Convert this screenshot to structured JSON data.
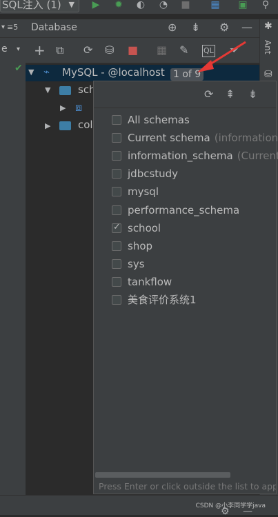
{
  "toolbar": {
    "run_config_label": "SQL注入 (1)",
    "icons": [
      "run-icon",
      "debug-icon",
      "coverage-icon",
      "profile-icon",
      "stop-icon",
      "build-icon",
      "console-icon",
      "search-icon"
    ]
  },
  "left_panel": {
    "count_label": "≡5",
    "dropdown_label": "e"
  },
  "database_panel": {
    "title": "Database",
    "header_icons": [
      "crosshair-icon",
      "collapse-icon",
      "settings-icon",
      "minimize-icon"
    ],
    "toolbar_icons": [
      "add-icon",
      "copy-icon",
      "refresh-icon",
      "data-source-properties-icon",
      "stop-icon",
      "table-icon",
      "edit-icon",
      "sql-console-icon",
      "filter-icon"
    ]
  },
  "tree": {
    "root_label": "MySQL - @localhost",
    "root_badge": "1 of 9",
    "children": [
      {
        "label": "sch"
      },
      {
        "label": ""
      },
      {
        "label": "col"
      }
    ]
  },
  "right_panel": {
    "ant_label": "Ant"
  },
  "popup": {
    "tool_icons": [
      "refresh-icon",
      "expand-all-icon",
      "collapse-all-icon"
    ],
    "items": [
      {
        "label": "All schemas",
        "hint": "",
        "checked": false
      },
      {
        "label": "Current schema",
        "hint": "(information_",
        "checked": false
      },
      {
        "label": "information_schema",
        "hint": "(Current",
        "checked": false
      },
      {
        "label": "jdbcstudy",
        "hint": "",
        "checked": false
      },
      {
        "label": "mysql",
        "hint": "",
        "checked": false
      },
      {
        "label": "performance_schema",
        "hint": "",
        "checked": false
      },
      {
        "label": "school",
        "hint": "",
        "checked": true
      },
      {
        "label": "shop",
        "hint": "",
        "checked": false
      },
      {
        "label": "sys",
        "hint": "",
        "checked": false
      },
      {
        "label": "tankflow",
        "hint": "",
        "checked": false
      },
      {
        "label": "美食评价系统1",
        "hint": "",
        "checked": false
      }
    ],
    "footer": "Press Enter or click outside the list to apply"
  },
  "watermark": "CSDN @小李同学学java",
  "colors": {
    "accent_green": "#499c54",
    "arrow_red": "#e53935",
    "folder_blue": "#3d7ea6",
    "selection": "#0d293e"
  }
}
